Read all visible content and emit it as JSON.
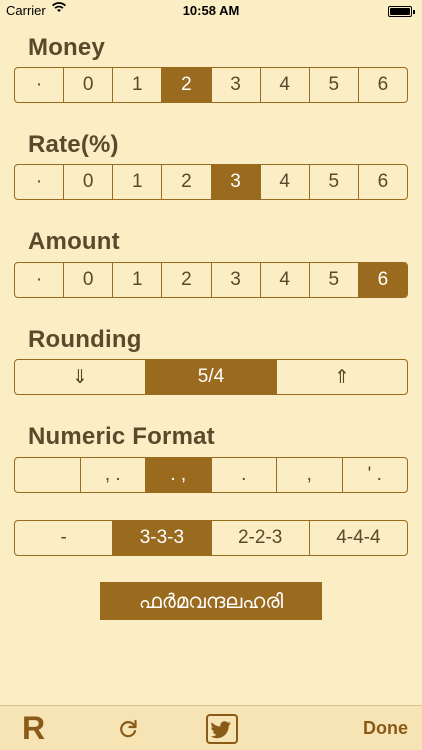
{
  "status_bar": {
    "carrier": "Carrier",
    "time": "10:58 AM"
  },
  "money": {
    "title": "Money",
    "segments": [
      "·",
      "0",
      "1",
      "2",
      "3",
      "4",
      "5",
      "6"
    ],
    "selected": "2"
  },
  "rate": {
    "title": "Rate(%)",
    "segments": [
      "·",
      "0",
      "1",
      "2",
      "3",
      "4",
      "5",
      "6"
    ],
    "selected": "3"
  },
  "amount": {
    "title": "Amount",
    "segments": [
      "·",
      "0",
      "1",
      "2",
      "3",
      "4",
      "5",
      "6"
    ],
    "selected": "6"
  },
  "rounding": {
    "title": "Rounding",
    "segments": [
      "⇓",
      "5/4",
      "⇑"
    ],
    "selected": "5/4"
  },
  "numeric_format": {
    "title": "Numeric Format",
    "separators": [
      "",
      ", .",
      ". ,",
      ".",
      ",",
      "' ."
    ],
    "separators_selected": ". ,",
    "grouping": [
      "-",
      "3-3-3",
      "2-2-3",
      "4-4-4"
    ],
    "grouping_selected": "3-3-3"
  },
  "malayalam_button": {
    "label": "ഫര്‍മവന്ദലഹരി"
  },
  "toolbar": {
    "logo": "R",
    "refresh_icon": "refresh-icon",
    "twitter_icon": "twitter-icon",
    "done_label": "Done"
  },
  "colors": {
    "background": "#fbeec4",
    "accent": "#9a6a1e",
    "text": "#5a4a2c"
  }
}
